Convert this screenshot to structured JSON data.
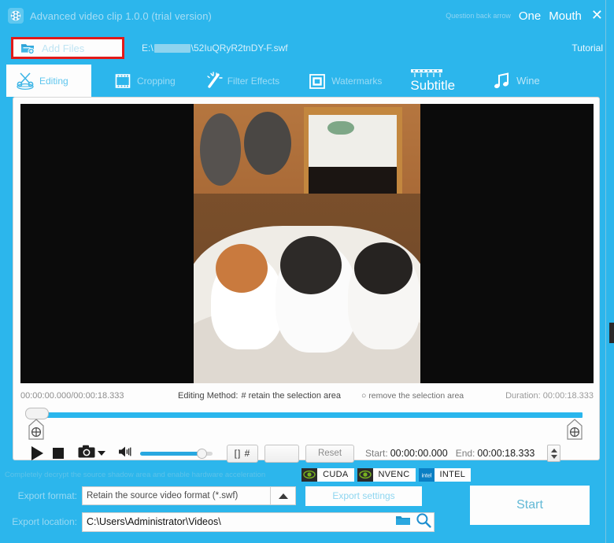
{
  "window": {
    "title": "Advanced video clip 1.0.0 (trial version)",
    "icon": "film-reel-icon",
    "accent": "#2cb6ec",
    "titlebar_right": {
      "hint": "Question back arrow",
      "item_one": "One",
      "item_two": "Mouth",
      "close": "✕"
    }
  },
  "toolbar": {
    "add_files_label": "Add Files",
    "add_files_icon": "add-folder-icon",
    "file_path_prefix": "E:\\",
    "file_path_suffix": "\\52IuQRyR2tnDY-F.swf",
    "tutorial_label": "Tutorial",
    "highlight_color": "#e21a1a"
  },
  "tabs": [
    {
      "label": "Editing",
      "icon": "scissors-icon",
      "active": true
    },
    {
      "label": "Cropping",
      "icon": "film-strip-icon",
      "active": false
    },
    {
      "label": "Filter Effects",
      "icon": "magic-wand-icon",
      "active": false
    },
    {
      "label": "Watermarks",
      "icon": "square-frame-icon",
      "active": false
    },
    {
      "label": "Subtitle",
      "icon": "subtitle-bar-icon",
      "active": false
    },
    {
      "label": "Wine",
      "icon": "music-note-icon",
      "active": false
    }
  ],
  "timeline": {
    "position_of_total": "00:00:00.000/00:00:18.333",
    "editing_method_label": "Editing Method:",
    "retain_marker": "#",
    "retain_label": "retain the selection area",
    "remove_marker": "○",
    "remove_label": "remove the selection area",
    "duration_label": "Duration: 00:00:18.333"
  },
  "controls": {
    "play_icon": "play-icon",
    "stop_icon": "stop-icon",
    "snapshot_icon": "camera-icon",
    "snapshot_dropdown_icon": "caret-down-icon",
    "volume_icon": "speaker-icon",
    "volume_percent": 78,
    "mark_button_label": "[] #",
    "blank_button_label": "",
    "reset_button_label": "Reset",
    "start_label": "Start:",
    "start_value": "00:00:00.000",
    "end_label": "End:",
    "end_value": "00:00:18.333",
    "spinner_icon": "spinner-up-down-icon"
  },
  "acceleration": {
    "note": "Completely decrypt the source shadow area and enable hardware acceleration",
    "badges": [
      {
        "label": "CUDA",
        "icon": "nvidia-eye-icon"
      },
      {
        "label": "NVENC",
        "icon": "nvidia-eye-icon"
      },
      {
        "label": "INTEL",
        "icon": "intel-logo-icon"
      }
    ]
  },
  "export": {
    "format_label": "Export format:",
    "format_value": "Retain the source video format (*.swf)",
    "format_dropdown_icon": "caret-up-icon",
    "settings_label": "Export settings",
    "location_label": "Export location:",
    "location_value": "C:\\Users\\Administrator\\Videos\\",
    "folder_icon": "folder-icon",
    "search_icon": "magnifier-icon",
    "start_button_label": "Start"
  }
}
